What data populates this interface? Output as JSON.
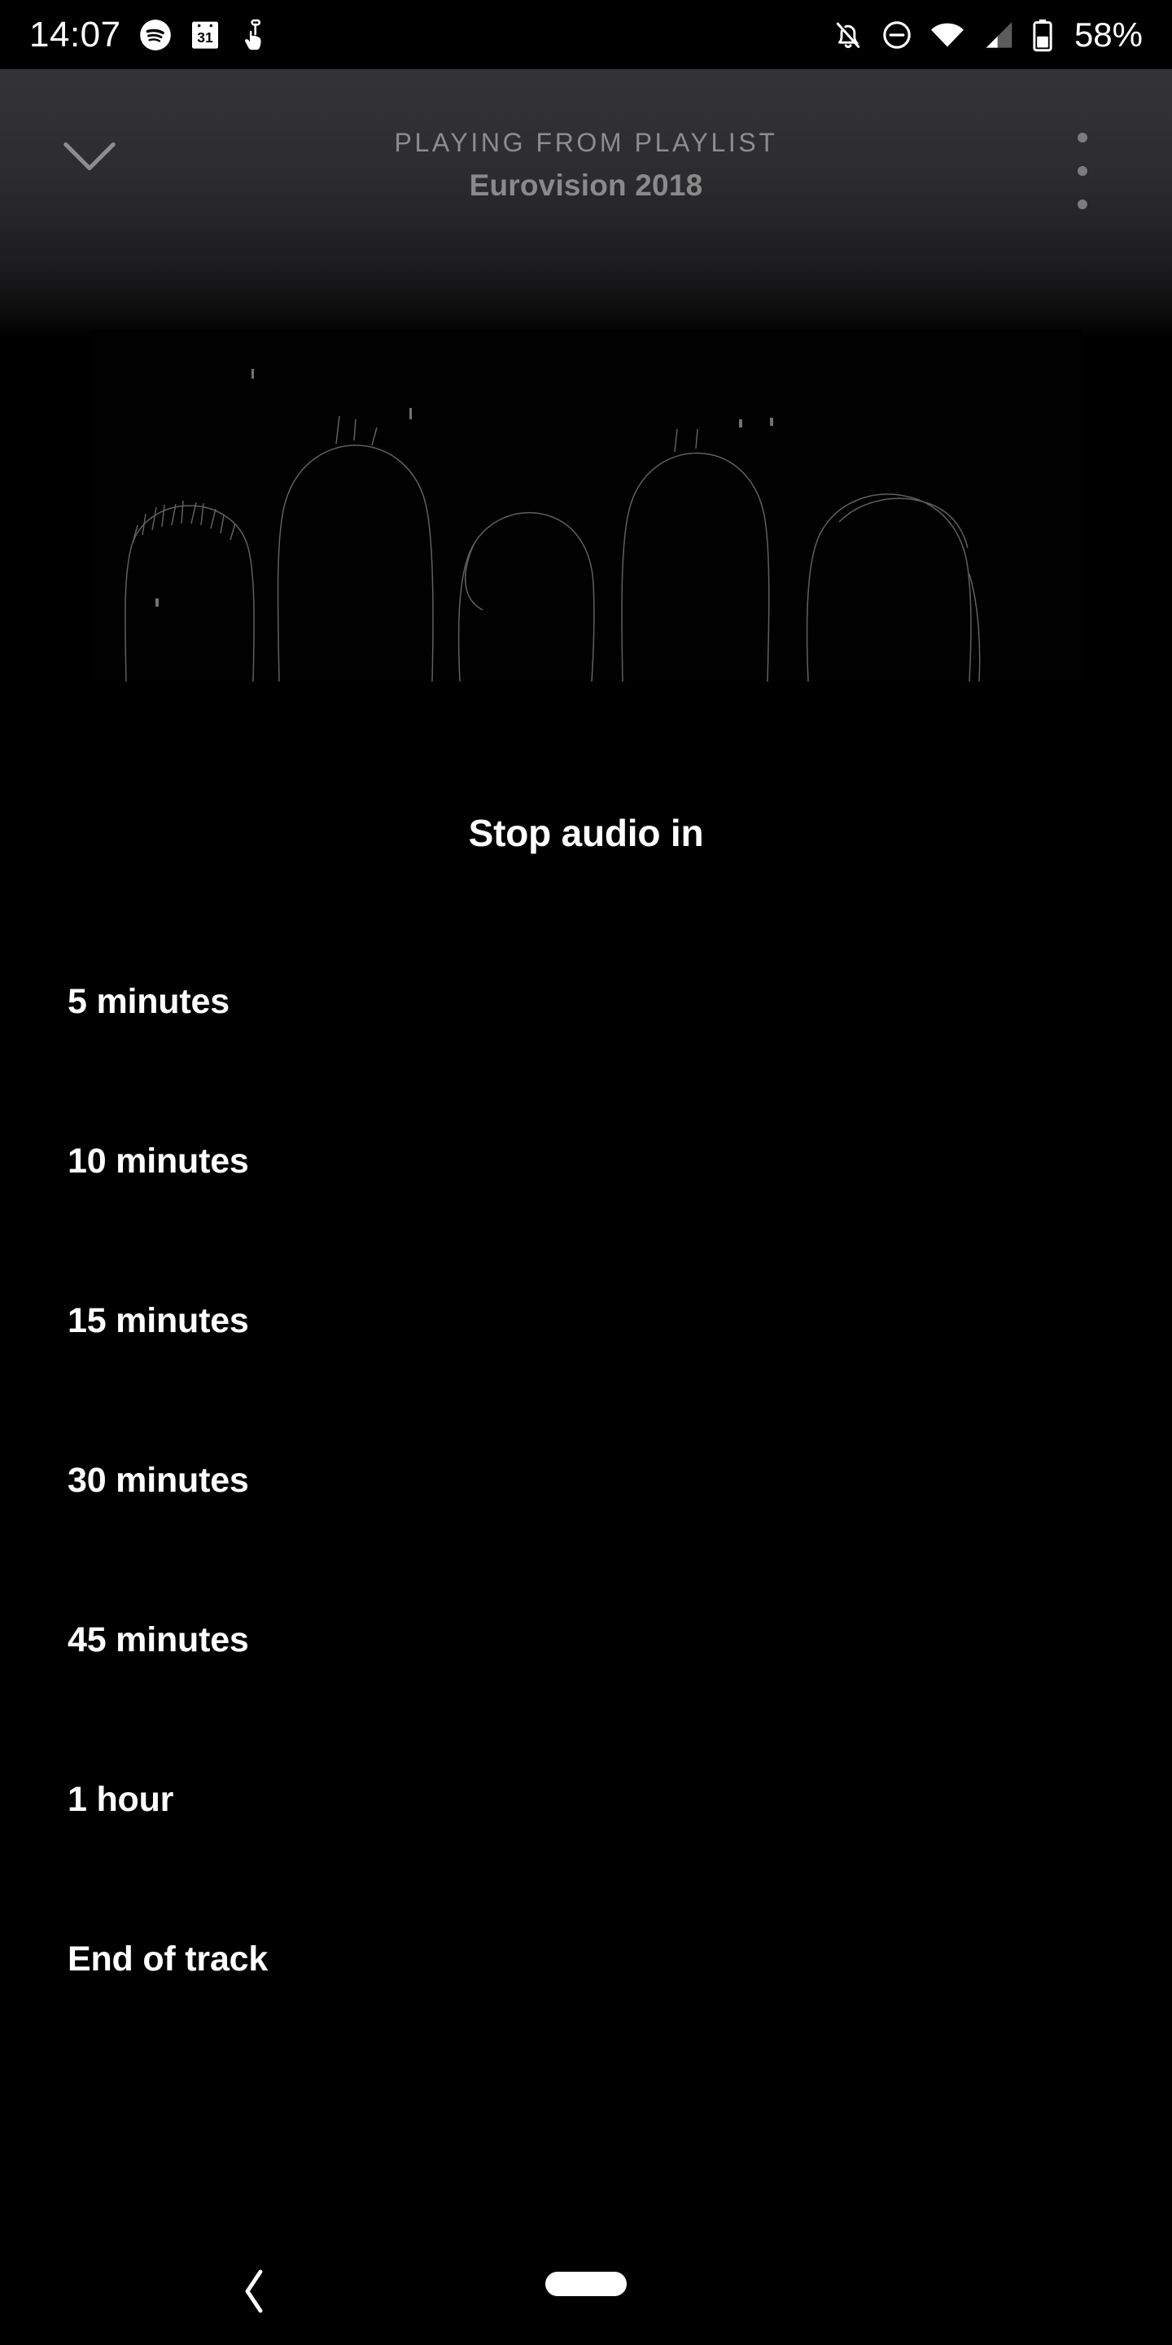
{
  "status_bar": {
    "time": "14:07",
    "battery_percent": "58%",
    "left_icons": [
      "spotify-icon",
      "calendar-31-icon",
      "reminder-hand-icon"
    ],
    "right_icons": [
      "notifications-off-icon",
      "do-not-disturb-icon",
      "wifi-icon",
      "cellular-signal-icon",
      "battery-icon"
    ],
    "calendar_day": "31"
  },
  "player_header": {
    "collapse_icon": "chevron-down-icon",
    "eyebrow": "PLAYING FROM PLAYLIST",
    "playlist_name": "Eurovision 2018",
    "overflow_icon": "more-vertical-icon"
  },
  "album_art": {
    "alt": "five silhouetted heads rim-lit on black background"
  },
  "sleep_timer": {
    "title": "Stop audio in",
    "options": [
      {
        "label": "5 minutes"
      },
      {
        "label": "10 minutes"
      },
      {
        "label": "15 minutes"
      },
      {
        "label": "30 minutes"
      },
      {
        "label": "45 minutes"
      },
      {
        "label": "1 hour"
      },
      {
        "label": "End of track"
      }
    ]
  },
  "navigation_bar": {
    "back_icon": "chevron-left-icon",
    "home_indicator": "home-pill-icon"
  },
  "colors": {
    "background": "#000000",
    "header_top": "#343437",
    "primary_text": "#ffffff",
    "muted_text": "#8d8d8d"
  }
}
